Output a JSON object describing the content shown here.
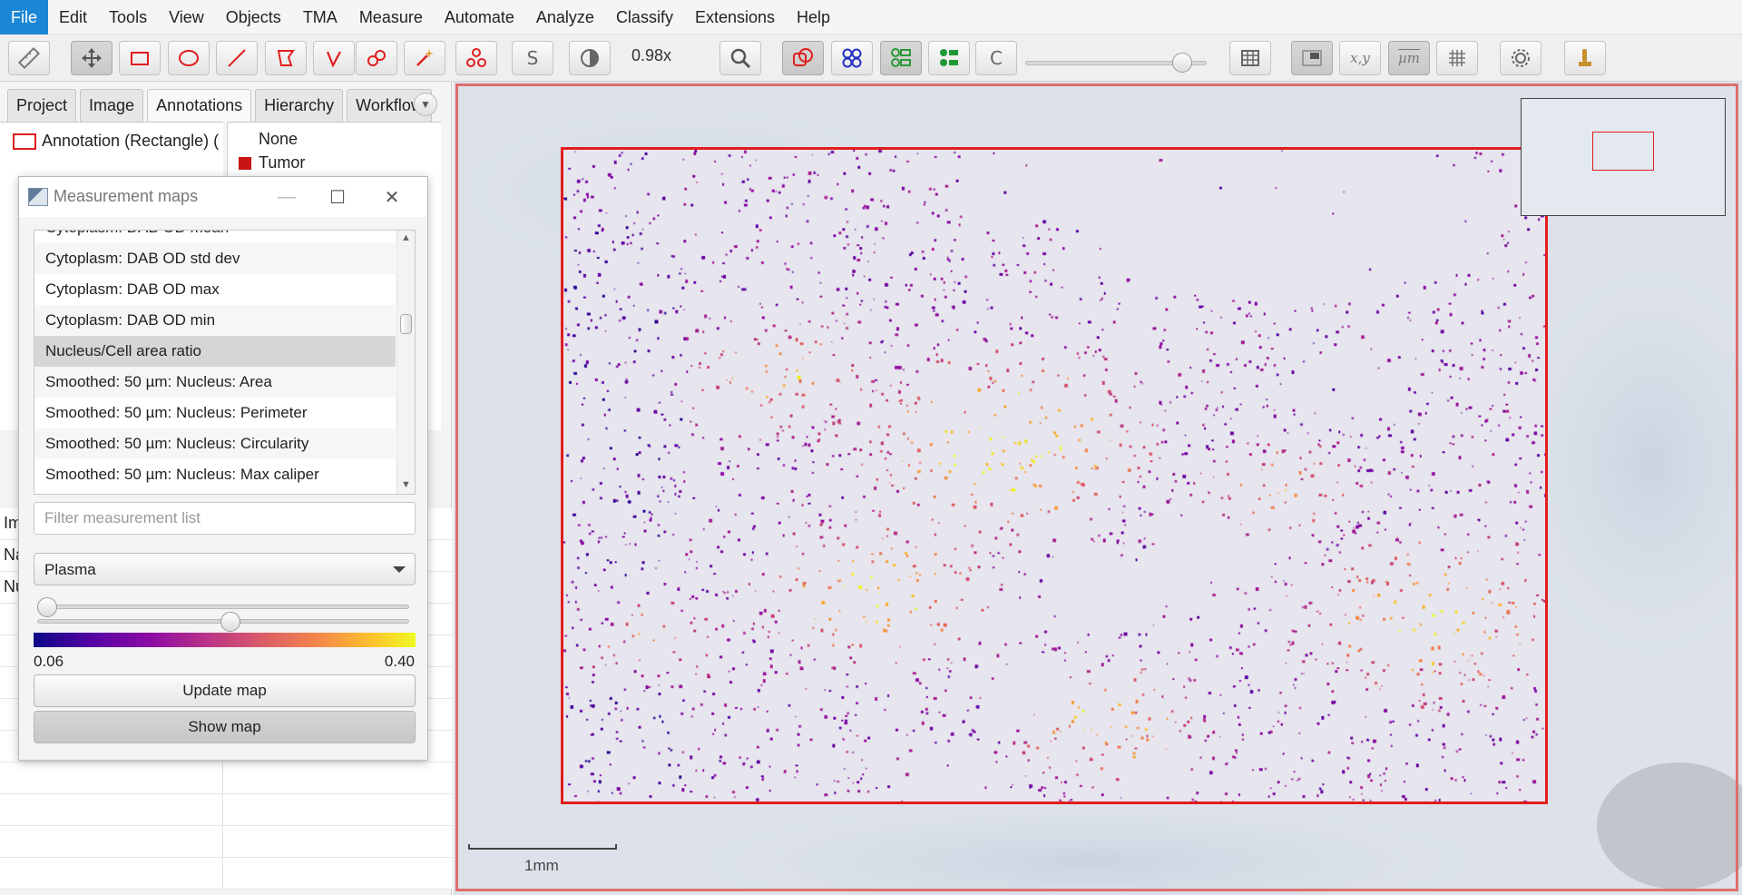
{
  "menu": [
    "File",
    "Edit",
    "Tools",
    "View",
    "Objects",
    "TMA",
    "Measure",
    "Automate",
    "Analyze",
    "Classify",
    "Extensions",
    "Help"
  ],
  "toolbar": {
    "zoom": "0.98x",
    "opacity_fraction": 0.9,
    "icons": [
      "ruler-icon",
      "move-icon",
      "rectangle-icon",
      "ellipse-icon",
      "line-icon",
      "polygon-icon",
      "polyline-icon",
      "brush-icon",
      "wand-icon",
      "points-icon",
      "selection-mode-icon",
      "brightness-contrast-icon",
      "zoom-to-fit-icon",
      "show-annotations-icon",
      "show-tma-grid-icon",
      "show-detections-icon",
      "fill-detections-icon",
      "show-connections-icon",
      "opacity-slider",
      "measurement-table-icon",
      "overview-icon",
      "cursor-location-icon",
      "scalebar-icon",
      "grid-icon",
      "settings-icon",
      "log-icon"
    ],
    "s_label": "S",
    "c_label": "C",
    "xy_label": "x,y",
    "um_label": "µm"
  },
  "left_panel": {
    "tabs": [
      "Project",
      "Image",
      "Annotations",
      "Hierarchy",
      "Workflow"
    ],
    "active_tab": "Annotations",
    "annotation_item": "Annotation (Rectangle) (",
    "classes": [
      {
        "name": "None",
        "color": ""
      },
      {
        "name": "Tumor",
        "color": "#c81414"
      }
    ],
    "row_fragments": [
      "Im",
      "Na",
      "Nu"
    ]
  },
  "dialog": {
    "title": "Measurement maps",
    "partial_top_item": "Cytoplasm: DAB OD mean",
    "items": [
      "Cytoplasm: DAB OD std dev",
      "Cytoplasm: DAB OD max",
      "Cytoplasm: DAB OD min",
      "Nucleus/Cell area ratio",
      "Smoothed: 50 µm: Nucleus: Area",
      "Smoothed: 50 µm: Nucleus: Perimeter",
      "Smoothed: 50 µm: Nucleus: Circularity",
      "Smoothed: 50 µm: Nucleus: Max caliper"
    ],
    "selected_item": "Nucleus/Cell area ratio",
    "filter_placeholder": "Filter measurement list",
    "colormap": "Plasma",
    "min_slider_fraction": 0.0,
    "max_slider_fraction": 0.52,
    "min_value": "0.06",
    "max_value": "0.40",
    "update_button": "Update map",
    "show_button": "Show map"
  },
  "viewer": {
    "scalebar_label": "1mm",
    "roi_color": "#e31c1c"
  },
  "colors": {
    "menu_active": "#1c86d6",
    "annotation": "#e21e1e"
  }
}
